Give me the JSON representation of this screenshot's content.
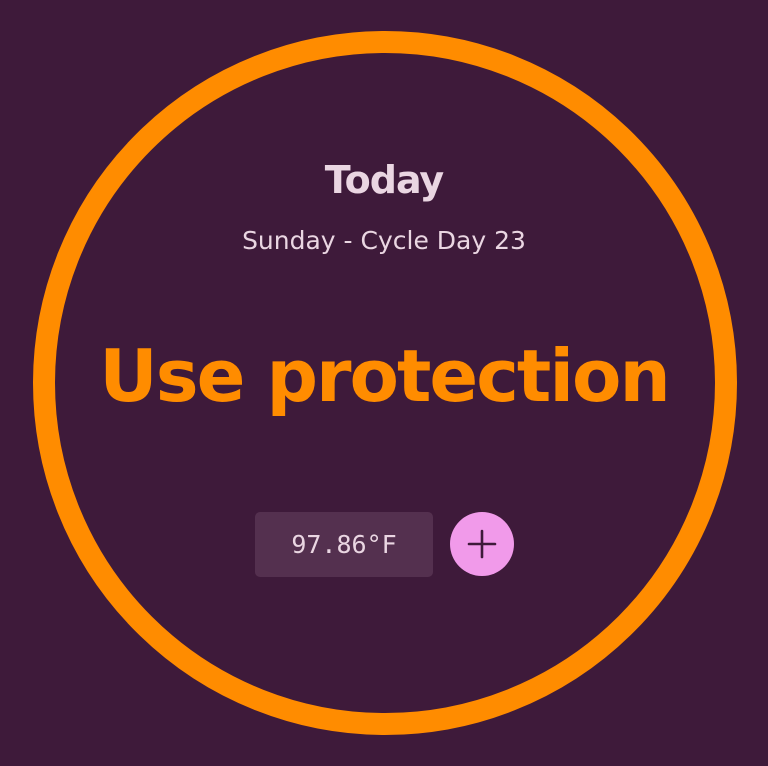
{
  "header": {
    "title": "Today",
    "subtitle": "Sunday - Cycle Day 23"
  },
  "status": {
    "label": "Use protection"
  },
  "temperature": {
    "value": "97.86°F"
  },
  "add_button": {
    "icon": "plus-icon"
  },
  "colors": {
    "background": "#3e1a3a",
    "accent": "#ff8c00",
    "text": "#ead6e2",
    "input_background": "#54304f",
    "button": "#f19aea"
  }
}
